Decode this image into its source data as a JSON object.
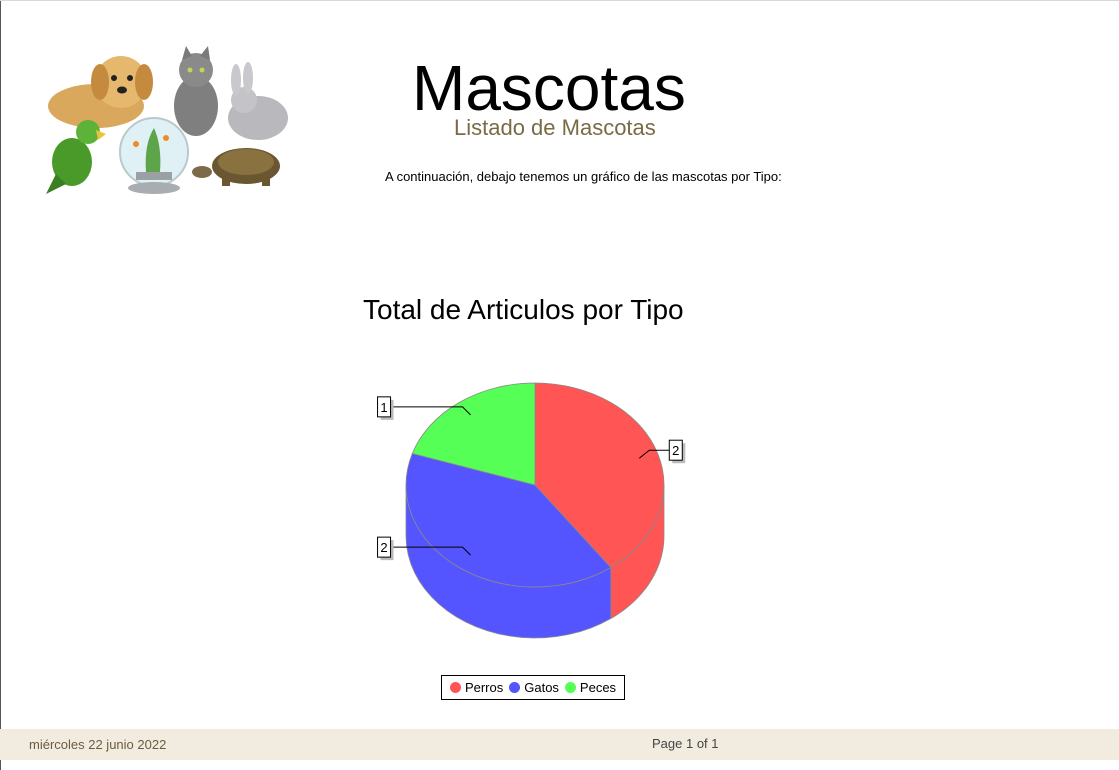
{
  "header": {
    "title": "Mascotas",
    "subtitle": "Listado de Mascotas",
    "intro": "A continuación, debajo tenemos un gráfico de las mascotas por Tipo:"
  },
  "chart_data": {
    "type": "pie",
    "title": "Total de Articulos por Tipo",
    "categories": [
      "Perros",
      "Gatos",
      "Peces"
    ],
    "values": [
      2,
      2,
      1
    ],
    "data_labels": [
      "2",
      "2",
      "1"
    ],
    "colors": [
      "#ff5555",
      "#5555ff",
      "#55ff55"
    ],
    "style": "3d",
    "legend_position": "bottom"
  },
  "legend": {
    "items": [
      {
        "label": "Perros",
        "color": "#ff5555"
      },
      {
        "label": "Gatos",
        "color": "#5555ff"
      },
      {
        "label": "Peces",
        "color": "#55ff55"
      }
    ]
  },
  "footer": {
    "date": "miércoles 22 junio 2022",
    "page": "Page 1 of 1"
  }
}
